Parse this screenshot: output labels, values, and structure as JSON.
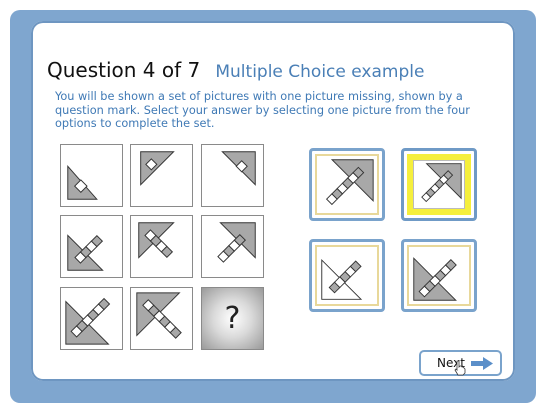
{
  "header": {
    "question_number": "Question 4 of 7",
    "question_type": "Multiple Choice example"
  },
  "instructions": "You will be shown a set of pictures with one picture missing, shown by a question mark. Select your answer by selecting one picture from the four options to complete the set.",
  "grid": {
    "missing_symbol": "?"
  },
  "options": {
    "selected_index": 1
  },
  "navigation": {
    "next_label": "Next"
  },
  "colors": {
    "frame": "#7fa6cf",
    "accent_text": "#3f79b5",
    "option_border": "#7aa3cc",
    "selected_highlight": "#f5ef3c",
    "shape_fill": "#a8a8a8"
  }
}
